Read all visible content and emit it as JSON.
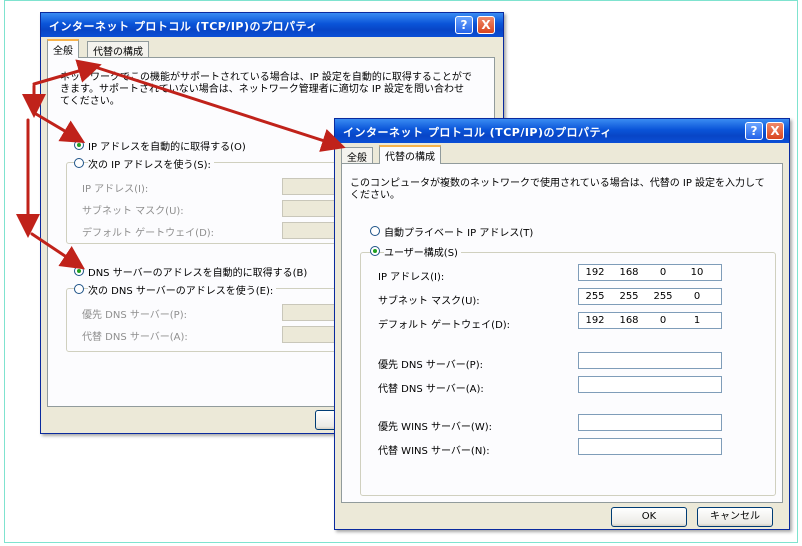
{
  "back_dialog": {
    "title": "インターネット プロトコル (TCP/IP)のプロパティ",
    "tabs": [
      "全般",
      "代替の構成"
    ],
    "description_line1": "ネットワークでこの機能がサポートされている場合は、IP 設定を自動的に取得することがで",
    "description_line2": "きます。サポートされていない場合は、ネットワーク管理者に適切な IP 設定を問い合わせ",
    "description_line3": "てください。",
    "radio_ip_auto": "IP アドレスを自動的に取得する(O)",
    "radio_ip_manual": "次の IP アドレスを使う(S):",
    "label_ip": "IP アドレス(I):",
    "label_subnet": "サブネット マスク(U):",
    "label_gateway": "デフォルト ゲートウェイ(D):",
    "radio_dns_auto": "DNS サーバーのアドレスを自動的に取得する(B)",
    "radio_dns_manual": "次の DNS サーバーのアドレスを使う(E):",
    "label_dns_pref": "優先 DNS サーバー(P):",
    "label_dns_alt": "代替 DNS サーバー(A):"
  },
  "front_dialog": {
    "title": "インターネット プロトコル (TCP/IP)のプロパティ",
    "tabs": [
      "全般",
      "代替の構成"
    ],
    "description_line1": "このコンピュータが複数のネットワークで使用されている場合は、代替の IP 設定を入力して",
    "description_line2": "ください。",
    "radio_apipa": "自動プライベート IP アドレス(T)",
    "radio_user": "ユーザー構成(S)",
    "label_ip": "IP アドレス(I):",
    "label_subnet": "サブネット マスク(U):",
    "label_gateway": "デフォルト ゲートウェイ(D):",
    "label_dns_pref": "優先 DNS サーバー(P):",
    "label_dns_alt": "代替 DNS サーバー(A):",
    "label_wins_pref": "優先 WINS サーバー(W):",
    "label_wins_alt": "代替 WINS サーバー(N):",
    "ip_address": [
      "192",
      "168",
      "0",
      "10"
    ],
    "subnet_mask": [
      "255",
      "255",
      "255",
      "0"
    ],
    "default_gateway": [
      "192",
      "168",
      "0",
      "1"
    ],
    "ok_label": "OK",
    "cancel_label": "キャンセル",
    "help_glyph": "?",
    "close_glyph": "X"
  },
  "colors": {
    "arrow": "#c0221a",
    "titlebar": "#0a54d8"
  }
}
